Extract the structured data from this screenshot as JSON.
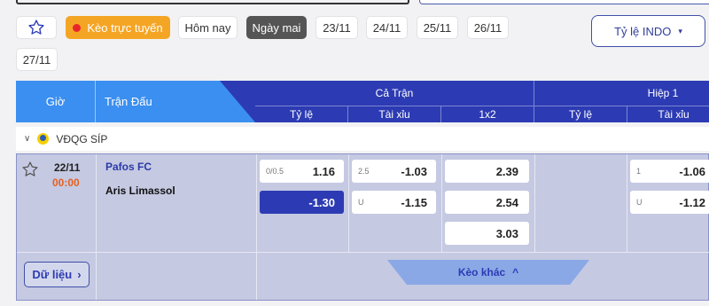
{
  "filters": {
    "live_label": "Kèo trực tuyến",
    "days": [
      "Hôm nay",
      "Ngày mai",
      "23/11",
      "24/11",
      "25/11",
      "26/11",
      "27/11"
    ],
    "selected_day": "Ngày mai",
    "odds_type": "Tỷ lệ INDO"
  },
  "table_header": {
    "time": "Giờ",
    "match": "Trận Đấu",
    "full_match": "Cả Trận",
    "first_half": "Hiệp 1",
    "cols": [
      "Tỷ lệ",
      "Tài xỉu",
      "1x2",
      "Tỷ lệ",
      "Tài xỉu"
    ]
  },
  "league": {
    "name": "VĐQG SÍP"
  },
  "match": {
    "date": "22/11",
    "time": "00:00",
    "home": "Pafos FC",
    "away": "Aris Limassol",
    "ft_handicap": [
      {
        "line": "0/0.5",
        "odds": "1.16"
      },
      {
        "line": "",
        "odds": "-1.30"
      }
    ],
    "ft_over_under": [
      {
        "line": "2.5",
        "odds": "-1.03"
      },
      {
        "line": "U",
        "odds": "-1.15"
      }
    ],
    "ft_1x2": [
      "2.39",
      "2.54",
      "3.03"
    ],
    "h1_over_under": [
      {
        "line": "1",
        "odds": "-1.06"
      },
      {
        "line": "U",
        "odds": "-1.12"
      }
    ]
  },
  "actions": {
    "data_label": "Dữ liệu",
    "more_label": "Kèo khác"
  },
  "colors": {
    "header_dark": "#2c3bb3",
    "header_light": "#3b8ff0",
    "live": "#f5a524",
    "time": "#e5611f"
  }
}
